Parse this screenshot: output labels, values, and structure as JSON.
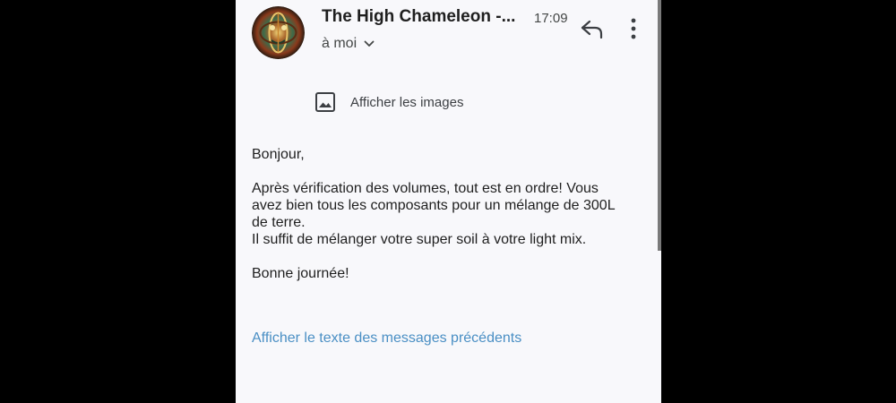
{
  "header": {
    "sender": "The High Chameleon -...",
    "time": "17:09",
    "recipient": "à moi"
  },
  "images_prompt": "Afficher les images",
  "body": {
    "greeting": "Bonjour,",
    "paragraph1_line1": "Après vérification des volumes, tout est en ordre! Vous",
    "paragraph1_line2": "avez bien tous les composants pour un mélange de 300L",
    "paragraph1_line3": "de terre.",
    "paragraph1_line4": "Il suffit de mélanger votre super soil à votre light mix.",
    "closing": "Bonne journée!"
  },
  "previous_messages_link": "Afficher le texte des messages précédents",
  "icons": {
    "avatar": "sender-avatar",
    "reply": "reply-icon",
    "more": "more-vert-icon",
    "recipient_toggle": "chevron-down-icon",
    "images": "image-icon"
  },
  "colors": {
    "background": "#f8f8fb",
    "link": "#4a8fc4",
    "text": "#1f1f1f"
  }
}
